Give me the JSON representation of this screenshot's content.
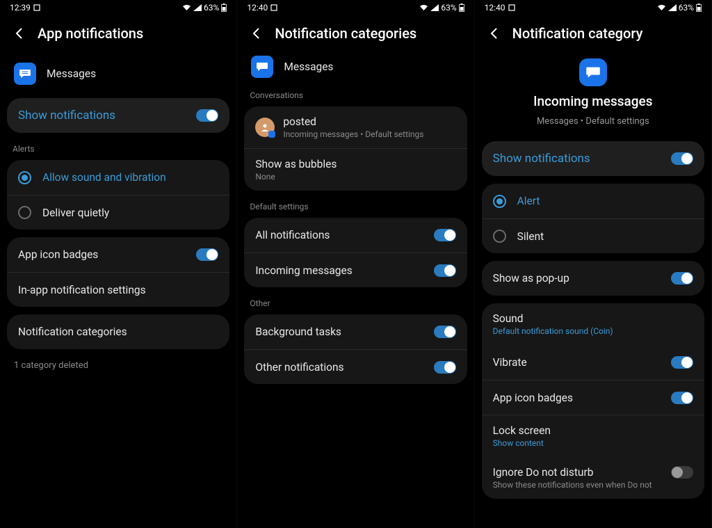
{
  "status": {
    "time1": "12:39",
    "time2": "12:40",
    "time3": "12:40",
    "battery": "63%"
  },
  "screen1": {
    "title": "App notifications",
    "app_name": "Messages",
    "show_notifications": "Show notifications",
    "alerts_header": "Alerts",
    "allow_sound": "Allow sound and vibration",
    "deliver_quietly": "Deliver quietly",
    "app_icon_badges": "App icon badges",
    "in_app_settings": "In-app notification settings",
    "notification_categories": "Notification categories",
    "footer": "1 category deleted"
  },
  "screen2": {
    "title": "Notification categories",
    "app_name": "Messages",
    "conversations_header": "Conversations",
    "posted": "posted",
    "posted_sub": "Incoming messages • Default settings",
    "show_bubbles": "Show as bubbles",
    "show_bubbles_sub": "None",
    "default_header": "Default settings",
    "all_notifications": "All notifications",
    "incoming_messages": "Incoming messages",
    "other_header": "Other",
    "background_tasks": "Background tasks",
    "other_notifications": "Other notifications"
  },
  "screen3": {
    "title": "Notification category",
    "header_title": "Incoming messages",
    "header_sub": "Messages • Default settings",
    "show_notifications": "Show notifications",
    "alert": "Alert",
    "silent": "Silent",
    "show_popup": "Show as pop-up",
    "sound": "Sound",
    "sound_sub": "Default notification sound (Coin)",
    "vibrate": "Vibrate",
    "app_icon_badges": "App icon badges",
    "lock_screen": "Lock screen",
    "lock_screen_sub": "Show content",
    "ignore_dnd": "Ignore Do not disturb",
    "ignore_dnd_sub": "Show these notifications even when Do not"
  }
}
